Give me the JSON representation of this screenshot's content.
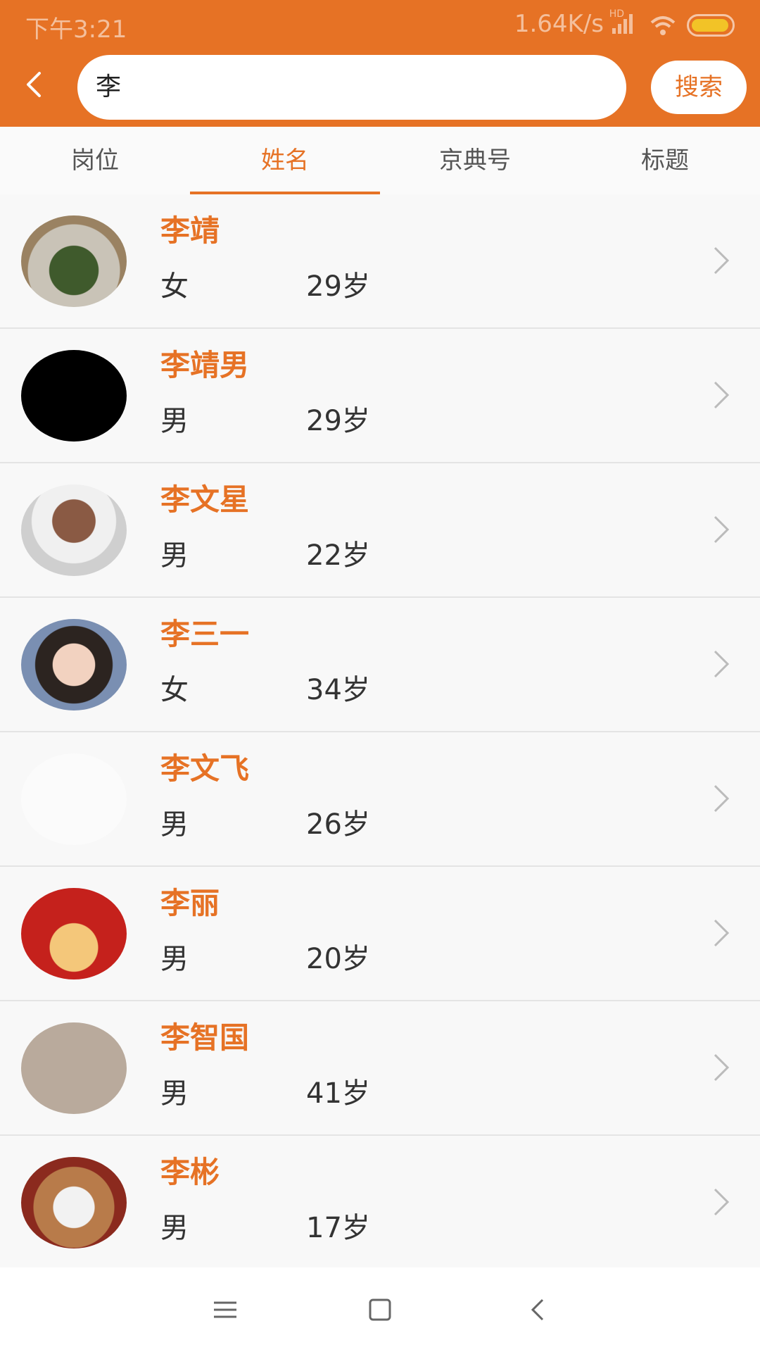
{
  "status_bar": {
    "time": "下午3:21",
    "network_speed": "1.64K/s",
    "hd_label": "HD",
    "battery_color": "#f2c327"
  },
  "header": {
    "search_value": "李",
    "search_button": "搜索",
    "accent_color": "#e67225"
  },
  "tabs": [
    {
      "label": "岗位",
      "active": false
    },
    {
      "label": "姓名",
      "active": true
    },
    {
      "label": "京典号",
      "active": false
    },
    {
      "label": "标题",
      "active": false
    }
  ],
  "results": [
    {
      "name": "李靖",
      "gender": "女",
      "age": "29岁",
      "avatar": "cactus-photo"
    },
    {
      "name": "李靖男",
      "gender": "男",
      "age": "29岁",
      "avatar": "black-image"
    },
    {
      "name": "李文星",
      "gender": "男",
      "age": "22岁",
      "avatar": "man-portrait"
    },
    {
      "name": "李三一",
      "gender": "女",
      "age": "34岁",
      "avatar": "woman-portrait"
    },
    {
      "name": "李文飞",
      "gender": "男",
      "age": "26岁",
      "avatar": "blank-white"
    },
    {
      "name": "李丽",
      "gender": "男",
      "age": "20岁",
      "avatar": "red-box-photo"
    },
    {
      "name": "李智国",
      "gender": "男",
      "age": "41岁",
      "avatar": "grey-blur"
    },
    {
      "name": "李彬",
      "gender": "男",
      "age": "17岁",
      "avatar": "cat-photo"
    }
  ],
  "navigation": {
    "menu_icon": "menu-icon",
    "home_icon": "square-icon",
    "back_icon": "back-triangle-icon"
  }
}
